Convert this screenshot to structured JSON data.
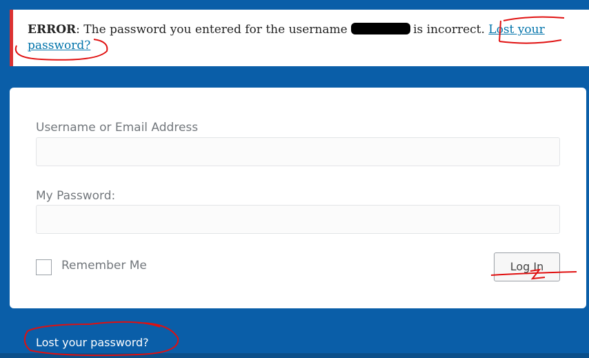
{
  "error": {
    "prefix": "ERROR",
    "message_start": ": The password you entered for the username ",
    "message_end": "is incorrect.",
    "link_text": "Lost your password?"
  },
  "form": {
    "username_label": "Username or Email Address",
    "username_value": "",
    "password_label": "My Password:",
    "password_value": "",
    "remember_label": "Remember Me",
    "remember_checked": false,
    "submit_label": "Log In"
  },
  "footer": {
    "lost_password_link": "Lost your password?"
  },
  "colors": {
    "background": "#0a5ea8",
    "error_border": "#dc3232",
    "link": "#0073aa",
    "annotation": "#e01010"
  },
  "icons": [
    "redaction-mark",
    "red-annotation-marks"
  ]
}
